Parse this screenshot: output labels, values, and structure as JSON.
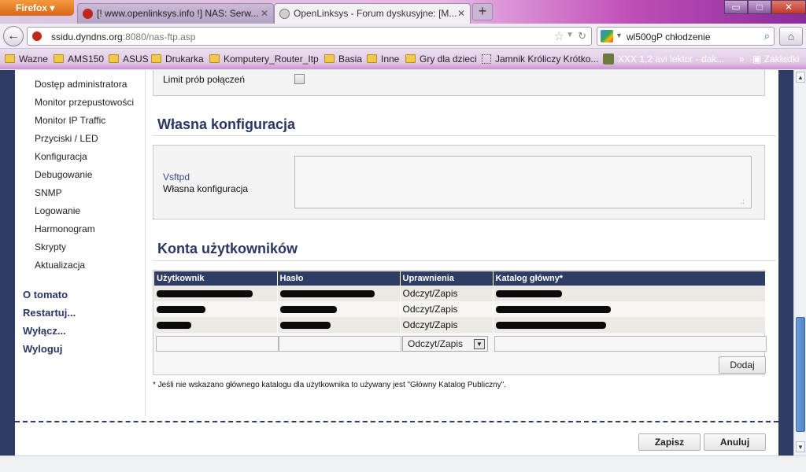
{
  "browser": {
    "app_button": "Firefox",
    "tabs": [
      {
        "title": "[! www.openlinksys.info !] NAS: Serw..."
      },
      {
        "title": "OpenLinksys - Forum dyskusyjne: [M..."
      }
    ],
    "url_host": "ssidu.dyndns.org",
    "url_path": ":8080/nas-ftp.asp",
    "search_query": "wl500gP chłodzenie",
    "bookmarks": [
      {
        "label": "Wazne"
      },
      {
        "label": "AMS150"
      },
      {
        "label": "ASUS"
      },
      {
        "label": "Drukarka"
      },
      {
        "label": "Komputery_Router_Itp"
      },
      {
        "label": "Basia"
      },
      {
        "label": "Inne"
      },
      {
        "label": "Gry dla dzieci"
      },
      {
        "label": "Jamnik Króliczy Krótko..."
      },
      {
        "label": "XXX 1,2 avi lektor - dak..."
      }
    ],
    "bookmarks_more": "»",
    "bookmarks_menu": "Zakładki",
    "window_buttons": {
      "minimize": "▭",
      "maximize": "□",
      "close": "✕"
    }
  },
  "sidebar": {
    "sub_items": [
      "Dostęp administratora",
      "Monitor przepustowości",
      "Monitor IP Traffic",
      "Przyciski / LED",
      "Konfiguracja",
      "Debugowanie",
      "SNMP",
      "Logowanie",
      "Harmonogram",
      "Skrypty",
      "Aktualizacja"
    ],
    "main_items": [
      "O tomato",
      "Restartuj...",
      "Wyłącz...",
      "Wyloguj"
    ]
  },
  "top_panel": {
    "limit_label": "Limit prób połączeń",
    "limit_checked": false
  },
  "custom_config": {
    "title": "Własna konfiguracja",
    "link": "Vsftpd",
    "label": "Własna konfiguracja",
    "value": ""
  },
  "users": {
    "title": "Konta użytkowników",
    "columns": [
      "Użytkownik",
      "Hasło",
      "Uprawnienia",
      "Katalog główny*"
    ],
    "rows": [
      {
        "permission": "Odczyt/Zapis"
      },
      {
        "permission": "Odczyt/Zapis"
      },
      {
        "permission": "Odczyt/Zapis"
      }
    ],
    "new_permission": "Odczyt/Zapis",
    "add_button": "Dodaj",
    "footnote": "* Jeśli nie wskazano głównego katalogu dla użytkownika to używany jest \"Główny Katalog Publiczny\"."
  },
  "actions": {
    "save": "Zapisz",
    "cancel": "Anuluj"
  }
}
